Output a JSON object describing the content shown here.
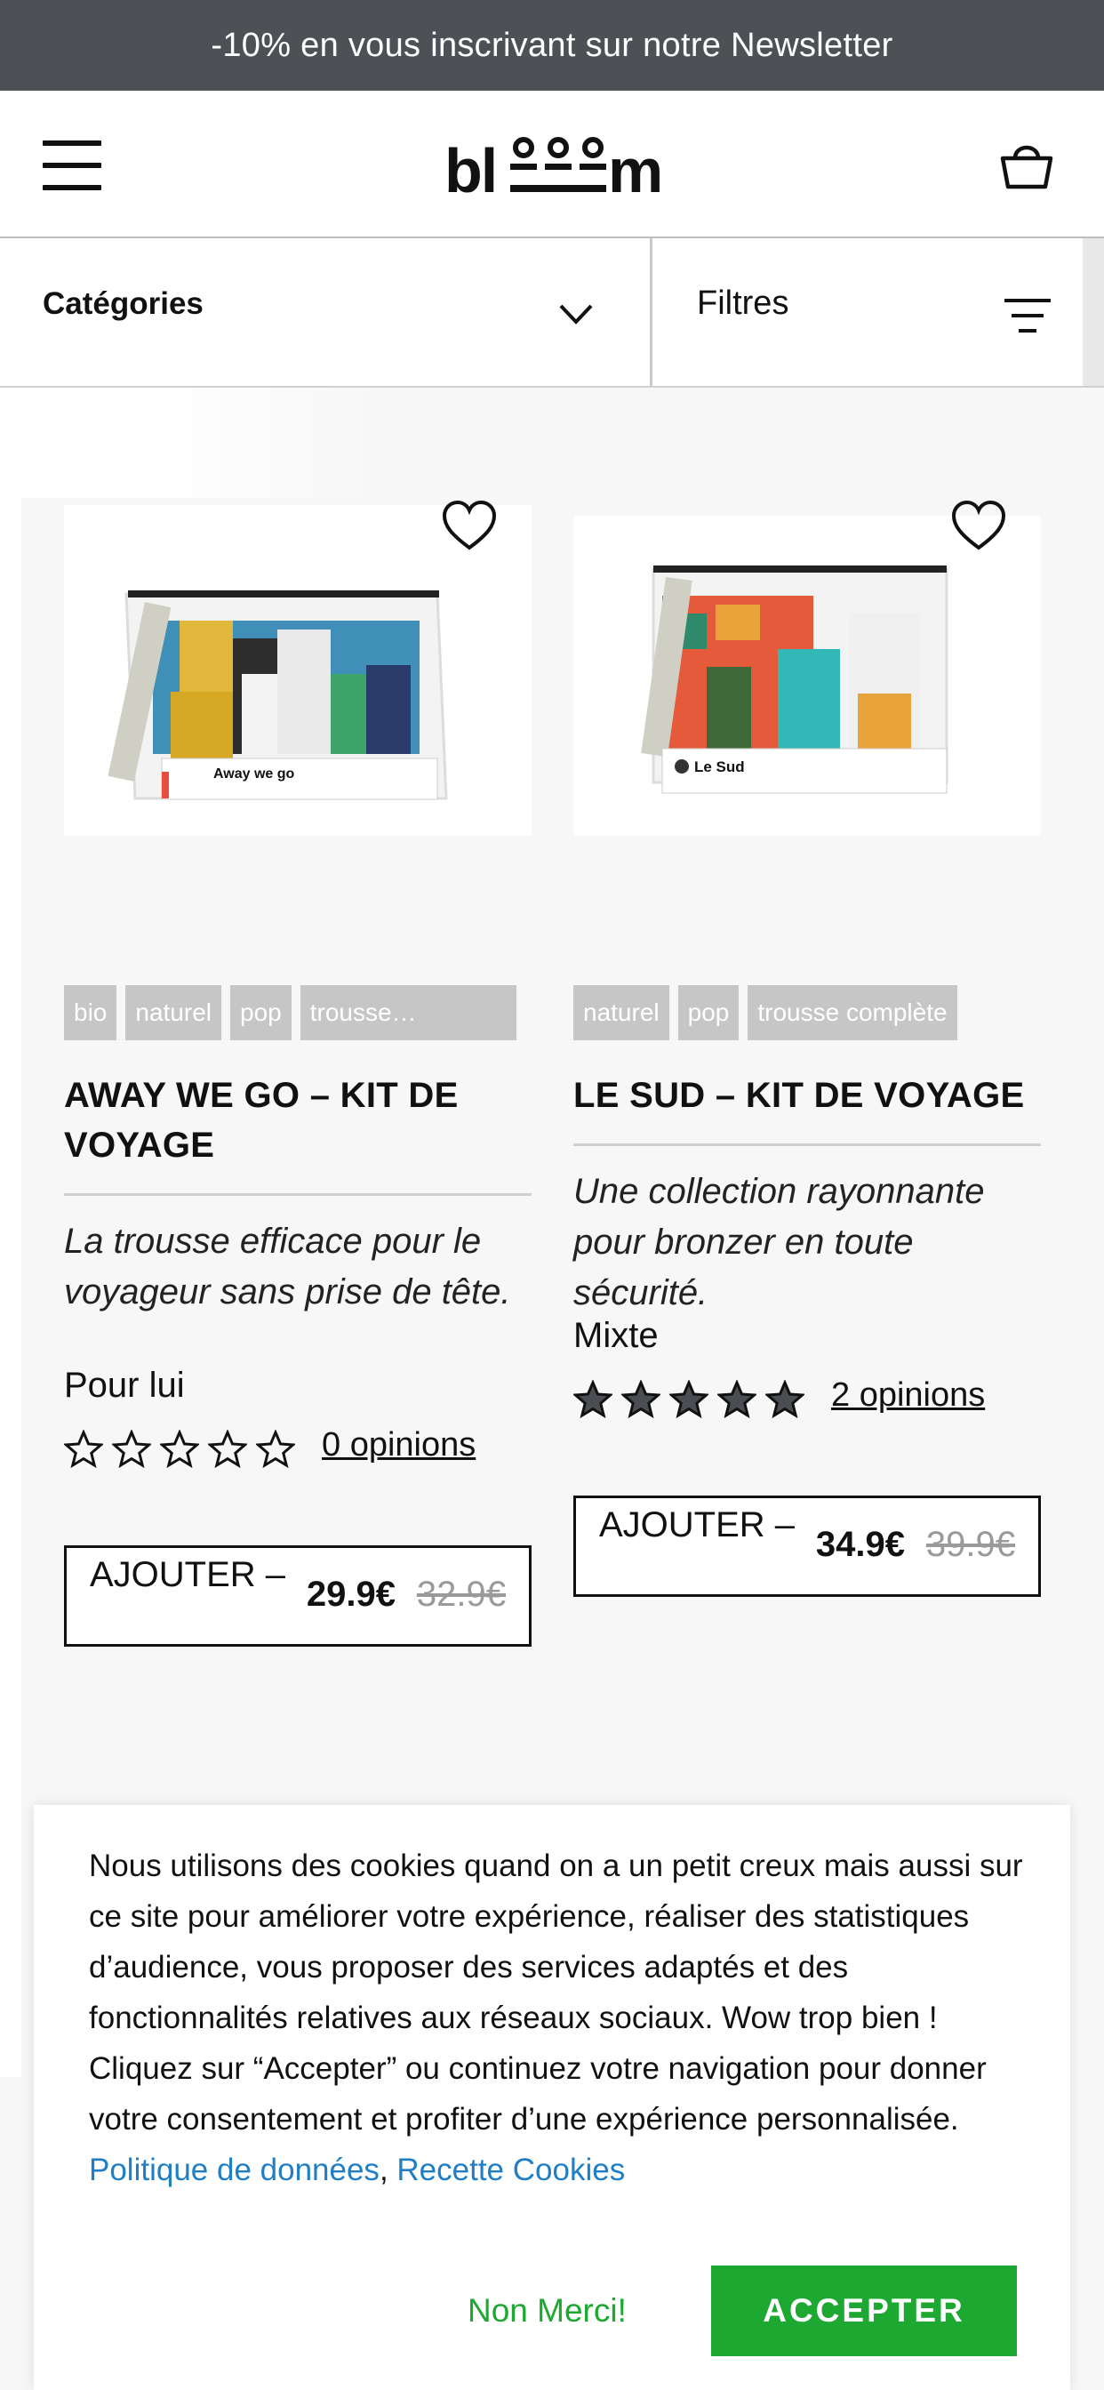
{
  "banner": {
    "text": "-10% en vous inscrivant sur notre Newsletter"
  },
  "header": {
    "logo_text": "blooom",
    "menu_icon": "hamburger-icon",
    "cart_icon": "basket-icon"
  },
  "filterbar": {
    "categories_label": "Catégories",
    "filters_label": "Filtres"
  },
  "products": [
    {
      "tags": [
        "bio",
        "naturel",
        "pop",
        "trousse…"
      ],
      "title": "AWAY WE GO - KIT DE VOYAGE",
      "title_line1": "AWAY WE GO – KIT DE",
      "title_line2": "VOYAGE",
      "description": "La trousse efficace pour le voyageur sans prise de tête.",
      "gender": "Pour lui",
      "rating": 0,
      "reviews": "0 opinions",
      "add_label": "AJOUTER –",
      "price": "29.9€",
      "old_price": "32.9€",
      "image_caption": "Away we go"
    },
    {
      "tags": [
        "naturel",
        "pop",
        "trousse complète"
      ],
      "title": "LE SUD – KIT DE VOYAGE",
      "description": "Une collection rayonnante pour bronzer en toute sécurité.",
      "gender": "Mixte",
      "rating": 5,
      "reviews": "2 opinions",
      "add_label": "AJOUTER –",
      "price": "34.9€",
      "old_price": "39.9€",
      "image_caption": "Le Sud"
    }
  ],
  "cookie": {
    "text_part1": "Nous utilisons des cookies quand on a un petit creux mais aussi sur ce site pour améliorer votre expérience, réaliser des statistiques d’audience, vous proposer des services adaptés et des fonctionnalités relatives aux réseaux sociaux. Wow trop bien !",
    "text_part2": "Cliquez sur “Accepter” ou continuez votre navigation pour donner votre consentement et profiter d’une expérience personnalisée.",
    "link1": "Politique de données",
    "separator": ",",
    "link2": "Recette Cookies",
    "decline": "Non Merci!",
    "accept": "ACCEPTER"
  },
  "colors": {
    "banner_bg": "#4d5156",
    "accept_green": "#1da832",
    "link_blue": "#1f7ec4",
    "tag_grey": "#c6c6c6",
    "star_dark": "#4a4d52"
  }
}
